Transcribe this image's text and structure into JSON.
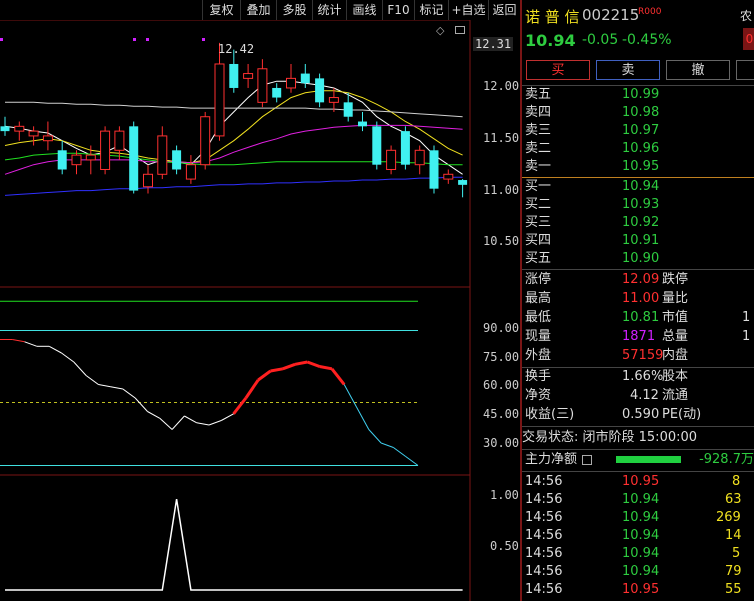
{
  "toolbar": {
    "buttons": [
      "复权",
      "叠加",
      "多股",
      "统计",
      "画线",
      "F10",
      "标记",
      "+自选",
      "返回"
    ]
  },
  "price_axis": {
    "labels": [
      "12.31",
      "12.00",
      "11.50",
      "11.00",
      "10.50"
    ],
    "high_marker": "12.42"
  },
  "indicator_axis": {
    "labels": [
      "90.00",
      "75.00",
      "60.00",
      "45.00",
      "30.00"
    ]
  },
  "volume_axis": {
    "labels": [
      "1.00",
      "0.50"
    ]
  },
  "stock": {
    "name": "诺 普 信",
    "code": "002215",
    "badge": "R",
    "badge_code": "000",
    "price": "10.94",
    "change": "-0.05",
    "change_pct": "-0.45%",
    "corner_text": "农",
    "corner_badge": "0"
  },
  "actions": {
    "buy": "买",
    "sell": "卖",
    "cancel": "撤"
  },
  "sell_orders": [
    {
      "label": "卖五",
      "price": "10.99"
    },
    {
      "label": "卖四",
      "price": "10.98"
    },
    {
      "label": "卖三",
      "price": "10.97"
    },
    {
      "label": "卖二",
      "price": "10.96"
    },
    {
      "label": "卖一",
      "price": "10.95"
    }
  ],
  "buy_orders": [
    {
      "label": "买一",
      "price": "10.94"
    },
    {
      "label": "买二",
      "price": "10.93"
    },
    {
      "label": "买三",
      "price": "10.92"
    },
    {
      "label": "买四",
      "price": "10.91"
    },
    {
      "label": "买五",
      "price": "10.90"
    }
  ],
  "stats": [
    {
      "label": "涨停",
      "value": "12.09",
      "label2": "跌停",
      "value2": ""
    },
    {
      "label": "最高",
      "value": "11.00",
      "label2": "量比",
      "value2": ""
    },
    {
      "label": "最低",
      "value": "10.81",
      "label2": "市值",
      "value2": "1"
    },
    {
      "label": "现量",
      "value": "1871",
      "label2": "总量",
      "value2": "1"
    },
    {
      "label": "外盘",
      "value": "57159",
      "label2": "内盘",
      "value2": ""
    }
  ],
  "fundamentals": [
    {
      "label": "换手",
      "value": "1.66%",
      "label2": "股本"
    },
    {
      "label": "净资",
      "value": "4.12",
      "label2": "流通"
    },
    {
      "label": "收益(三)",
      "value": "0.590",
      "label2": "PE(动)"
    }
  ],
  "trade_status": "交易状态: 闭市阶段 15:00:00",
  "main_flow": {
    "label": "主力净额",
    "value": "-928.7万",
    "bar_fraction": 0.65
  },
  "ticks": [
    {
      "time": "14:56",
      "price": "10.95",
      "vol": "8"
    },
    {
      "time": "14:56",
      "price": "10.94",
      "vol": "63"
    },
    {
      "time": "14:56",
      "price": "10.94",
      "vol": "269"
    },
    {
      "time": "14:56",
      "price": "10.94",
      "vol": "14"
    },
    {
      "time": "14:56",
      "price": "10.94",
      "vol": "5"
    },
    {
      "time": "14:56",
      "price": "10.94",
      "vol": "79"
    },
    {
      "time": "14:56",
      "price": "10.95",
      "vol": "55"
    }
  ],
  "chart_data": {
    "type": "candlestick",
    "price_ylim": [
      10.0,
      12.45
    ],
    "candles": [
      {
        "o": 11.55,
        "h": 11.65,
        "l": 11.45,
        "c": 11.5
      },
      {
        "o": 11.5,
        "h": 11.6,
        "l": 11.4,
        "c": 11.55
      },
      {
        "o": 11.45,
        "h": 11.55,
        "l": 11.35,
        "c": 11.5
      },
      {
        "o": 11.4,
        "h": 11.6,
        "l": 11.3,
        "c": 11.45
      },
      {
        "o": 11.3,
        "h": 11.4,
        "l": 11.05,
        "c": 11.1
      },
      {
        "o": 11.15,
        "h": 11.3,
        "l": 11.05,
        "c": 11.25
      },
      {
        "o": 11.2,
        "h": 11.35,
        "l": 11.05,
        "c": 11.25
      },
      {
        "o": 11.1,
        "h": 11.55,
        "l": 11.05,
        "c": 11.5
      },
      {
        "o": 11.3,
        "h": 11.55,
        "l": 11.2,
        "c": 11.5
      },
      {
        "o": 11.55,
        "h": 11.6,
        "l": 10.85,
        "c": 10.88
      },
      {
        "o": 10.92,
        "h": 11.15,
        "l": 10.85,
        "c": 11.05
      },
      {
        "o": 11.05,
        "h": 11.55,
        "l": 11.0,
        "c": 11.45
      },
      {
        "o": 11.3,
        "h": 11.35,
        "l": 11.05,
        "c": 11.1
      },
      {
        "o": 11.0,
        "h": 11.25,
        "l": 10.95,
        "c": 11.15
      },
      {
        "o": 11.15,
        "h": 11.7,
        "l": 11.1,
        "c": 11.65
      },
      {
        "o": 11.45,
        "h": 12.42,
        "l": 11.4,
        "c": 12.2
      },
      {
        "o": 12.2,
        "h": 12.35,
        "l": 11.9,
        "c": 11.95
      },
      {
        "o": 12.05,
        "h": 12.2,
        "l": 11.95,
        "c": 12.1
      },
      {
        "o": 11.8,
        "h": 12.25,
        "l": 11.75,
        "c": 12.15
      },
      {
        "o": 11.95,
        "h": 12.0,
        "l": 11.8,
        "c": 11.85
      },
      {
        "o": 11.95,
        "h": 12.2,
        "l": 11.9,
        "c": 12.05
      },
      {
        "o": 12.1,
        "h": 12.2,
        "l": 11.95,
        "c": 12.0
      },
      {
        "o": 12.05,
        "h": 12.1,
        "l": 11.75,
        "c": 11.8
      },
      {
        "o": 11.8,
        "h": 11.95,
        "l": 11.7,
        "c": 11.85
      },
      {
        "o": 11.8,
        "h": 11.9,
        "l": 11.6,
        "c": 11.65
      },
      {
        "o": 11.6,
        "h": 11.7,
        "l": 11.5,
        "c": 11.55
      },
      {
        "o": 11.55,
        "h": 11.6,
        "l": 11.1,
        "c": 11.15
      },
      {
        "o": 11.1,
        "h": 11.35,
        "l": 11.05,
        "c": 11.3
      },
      {
        "o": 11.5,
        "h": 11.55,
        "l": 11.1,
        "c": 11.15
      },
      {
        "o": 11.15,
        "h": 11.35,
        "l": 11.05,
        "c": 11.3
      },
      {
        "o": 11.3,
        "h": 11.35,
        "l": 10.85,
        "c": 10.9
      },
      {
        "o": 11.0,
        "h": 11.1,
        "l": 10.95,
        "c": 11.05
      },
      {
        "o": 10.99,
        "h": 11.0,
        "l": 10.81,
        "c": 10.94
      }
    ],
    "ma_series": [
      {
        "color": "#ffffff",
        "values": [
          11.55,
          11.53,
          11.5,
          11.48,
          11.4,
          11.32,
          11.25,
          11.28,
          11.35,
          11.25,
          11.15,
          11.2,
          11.18,
          11.15,
          11.3,
          11.55,
          11.7,
          11.85,
          11.98,
          12.02,
          12.02,
          12.0,
          11.98,
          11.95,
          11.88,
          11.8,
          11.65,
          11.55,
          11.48,
          11.4,
          11.25,
          11.15,
          11.05
        ]
      },
      {
        "color": "#f0e020",
        "values": [
          11.35,
          11.38,
          11.4,
          11.42,
          11.4,
          11.35,
          11.3,
          11.28,
          11.27,
          11.25,
          11.22,
          11.2,
          11.18,
          11.17,
          11.2,
          11.3,
          11.4,
          11.52,
          11.65,
          11.75,
          11.85,
          11.9,
          11.92,
          11.92,
          11.9,
          11.85,
          11.78,
          11.7,
          11.6,
          11.52,
          11.42,
          11.32,
          11.25
        ]
      },
      {
        "color": "#e020e0",
        "values": [
          11.05,
          11.1,
          11.15,
          11.18,
          11.2,
          11.2,
          11.2,
          11.2,
          11.2,
          11.2,
          11.18,
          11.18,
          11.18,
          11.17,
          11.18,
          11.22,
          11.28,
          11.33,
          11.38,
          11.42,
          11.47,
          11.5,
          11.52,
          11.54,
          11.55,
          11.56,
          11.56,
          11.56,
          11.56,
          11.55,
          11.54,
          11.53,
          11.52
        ]
      },
      {
        "color": "#20e020",
        "values": [
          11.2,
          11.22,
          11.25,
          11.26,
          11.27,
          11.27,
          11.26,
          11.25,
          11.24,
          11.22,
          11.2,
          11.18,
          11.17,
          11.16,
          11.15,
          11.15,
          11.15,
          11.16,
          11.17,
          11.18,
          11.18,
          11.18,
          11.18,
          11.18,
          11.18,
          11.18,
          11.18,
          11.18,
          11.17,
          11.17,
          11.16,
          11.15,
          11.15
        ]
      },
      {
        "color": "#d0d0d0",
        "values": [
          11.8,
          11.8,
          11.8,
          11.79,
          11.79,
          11.78,
          11.78,
          11.77,
          11.77,
          11.76,
          11.76,
          11.75,
          11.75,
          11.74,
          11.74,
          11.74,
          11.74,
          11.74,
          11.74,
          11.74,
          11.74,
          11.74,
          11.73,
          11.73,
          11.72,
          11.72,
          11.71,
          11.7,
          11.69,
          11.68,
          11.67,
          11.66,
          11.65
        ]
      },
      {
        "color": "#3030ff",
        "values": [
          10.83,
          10.84,
          10.85,
          10.86,
          10.87,
          10.88,
          10.88,
          10.89,
          10.9,
          10.9,
          10.91,
          10.91,
          10.92,
          10.92,
          10.93,
          10.94,
          10.94,
          10.95,
          10.95,
          10.96,
          10.96,
          10.97,
          10.97,
          10.98,
          10.98,
          10.99,
          10.99,
          11.0,
          11.0,
          11.01,
          11.01,
          11.02,
          11.02
        ]
      }
    ],
    "indicator_ylim": [
      20,
      100
    ],
    "indicator_upper": 95,
    "indicator_lower": 22,
    "indicator_mid_line": 82,
    "indicator_dashed": 50,
    "indicator_values": [
      78,
      78,
      77,
      75,
      75,
      72,
      68,
      62,
      58,
      57,
      56,
      52,
      46,
      43,
      38,
      44,
      41,
      40,
      42,
      45,
      52,
      60,
      64,
      65,
      67,
      68,
      66,
      65,
      58,
      48,
      38,
      32,
      30,
      26,
      22
    ],
    "volume_ylim": [
      0,
      1.1
    ],
    "volume_values": [
      0,
      0,
      0,
      0,
      0,
      0,
      0,
      0,
      0,
      0,
      0,
      0,
      1.0,
      0,
      0,
      0,
      0,
      0,
      0,
      0,
      0,
      0,
      0,
      0,
      0,
      0,
      0,
      0,
      0,
      0,
      0,
      0,
      0
    ]
  }
}
